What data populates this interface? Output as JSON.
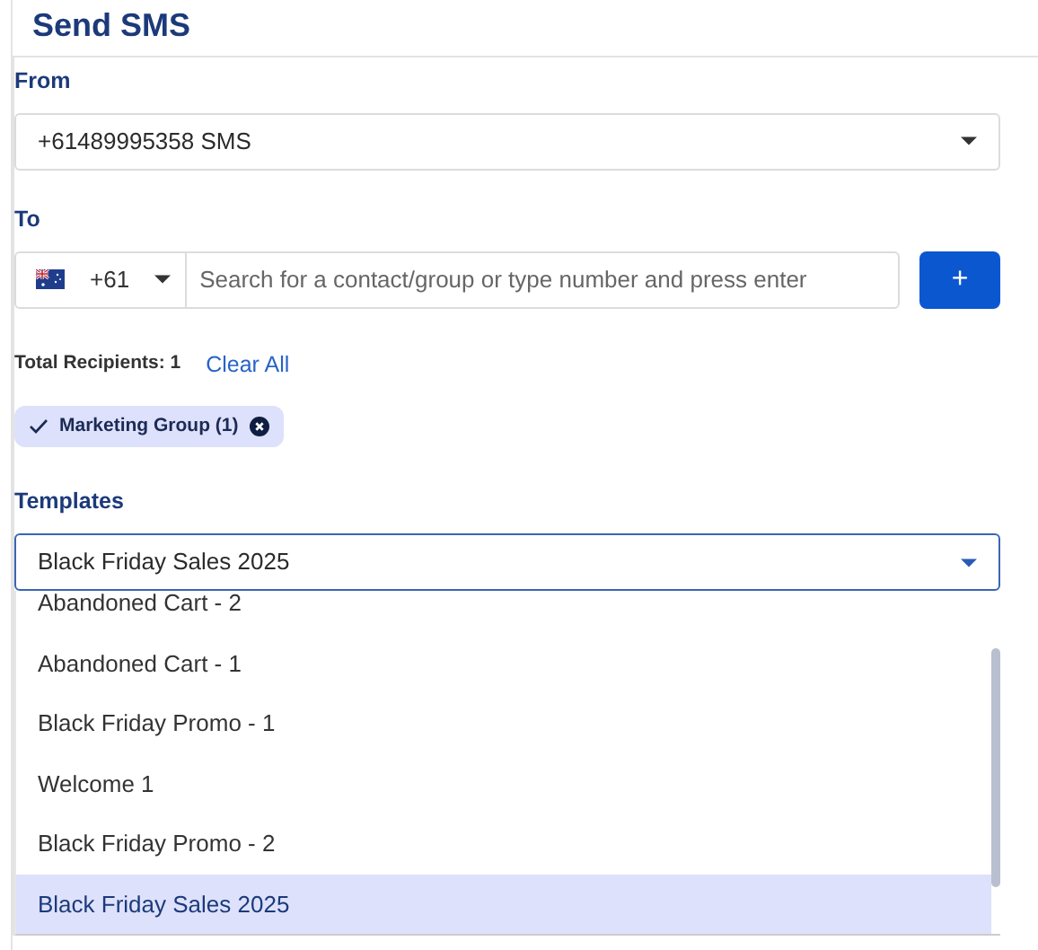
{
  "title": "Send SMS",
  "from": {
    "label": "From",
    "value": "+61489995358 SMS"
  },
  "to": {
    "label": "To",
    "country_code": "+61",
    "placeholder": "Search for a contact/group or type number and press enter",
    "add_button": "+"
  },
  "recipients": {
    "label": "Total Recipients:",
    "count": "1",
    "clear_link": "Clear All"
  },
  "chips": [
    {
      "label": "Marketing Group (1)",
      "selected": true
    }
  ],
  "templates": {
    "label": "Templates",
    "value": "Black Friday Sales 2025",
    "expanded": true,
    "options": [
      {
        "label": "Abandoned Cart - 2",
        "selected": false
      },
      {
        "label": "Abandoned Cart - 1",
        "selected": false
      },
      {
        "label": "Black Friday Promo - 1",
        "selected": false
      },
      {
        "label": "Welcome 1",
        "selected": false
      },
      {
        "label": "Black Friday Promo - 2",
        "selected": false
      },
      {
        "label": "Black Friday Sales 2025",
        "selected": true
      }
    ]
  }
}
